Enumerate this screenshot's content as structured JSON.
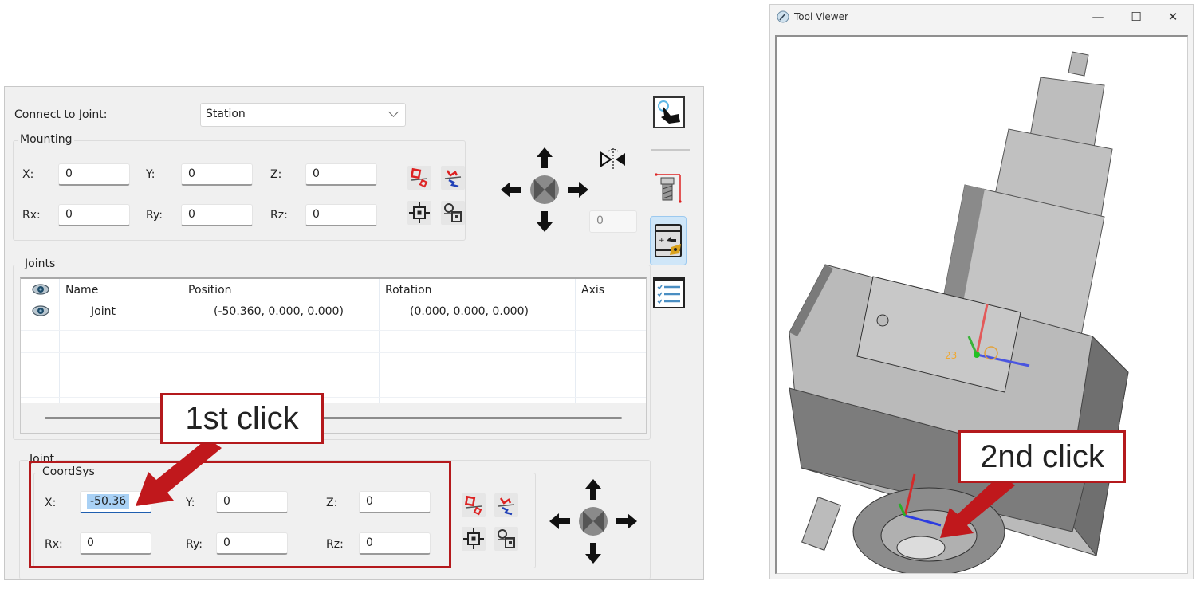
{
  "panel": {
    "connect_label": "Connect to Joint:",
    "connect_value": "Station",
    "mounting": {
      "title": "Mounting",
      "fields": [
        {
          "label": "X:",
          "value": "0"
        },
        {
          "label": "Y:",
          "value": "0"
        },
        {
          "label": "Z:",
          "value": "0"
        },
        {
          "label": "Rx:",
          "value": "0"
        },
        {
          "label": "Ry:",
          "value": "0"
        },
        {
          "label": "Rz:",
          "value": "0"
        }
      ]
    },
    "side_value": "0",
    "joints": {
      "title": "Joints",
      "columns": [
        "Name",
        "Position",
        "Rotation",
        "Axis"
      ],
      "rows": [
        {
          "name": "Joint",
          "position": "(-50.360, 0.000, 0.000)",
          "rotation": "(0.000, 0.000, 0.000)",
          "axis": ""
        }
      ]
    },
    "joint": {
      "title": "Joint",
      "coordsys": {
        "title": "CoordSys",
        "fields": [
          {
            "label": "X:",
            "value": "-50.36"
          },
          {
            "label": "Y:",
            "value": "0"
          },
          {
            "label": "Z:",
            "value": "0"
          },
          {
            "label": "Rx:",
            "value": "0"
          },
          {
            "label": "Ry:",
            "value": "0"
          },
          {
            "label": "Rz:",
            "value": "0"
          }
        ]
      }
    },
    "toolbar_icons": [
      "touch-select-icon",
      "tool-length-icon",
      "tool-holder-icon",
      "checklist-icon"
    ]
  },
  "annotations": {
    "first": "1st click",
    "second": "2nd click",
    "color": "#b4191c"
  },
  "viewer": {
    "title": "Tool Viewer",
    "minimize": "—",
    "maximize": "☐",
    "close": "✕",
    "csys_label": "23"
  }
}
